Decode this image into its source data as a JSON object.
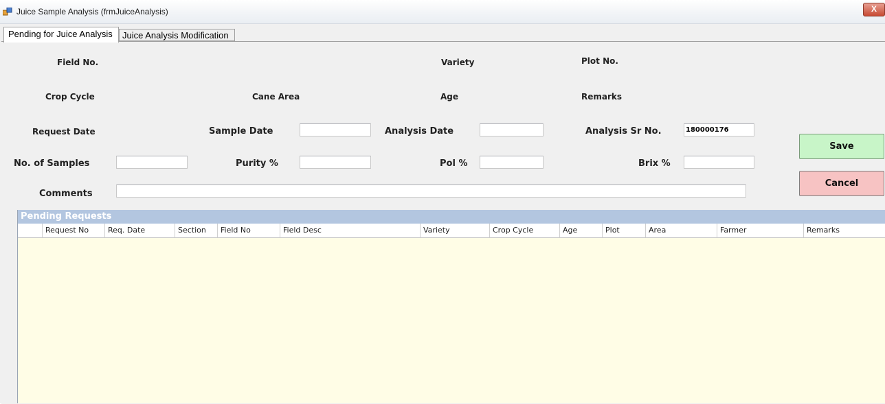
{
  "window": {
    "title": "Juice Sample Analysis (frmJuiceAnalysis)",
    "close_label": "X"
  },
  "tabs": [
    {
      "label": "Pending for Juice Analysis",
      "active": true
    },
    {
      "label": "Juice Analysis Modification",
      "active": false
    }
  ],
  "form": {
    "field_no": "Field No.",
    "variety": "Variety",
    "plot_no": "Plot No.",
    "crop_cycle": "Crop Cycle",
    "cane_area": "Cane Area",
    "age": "Age",
    "remarks": "Remarks",
    "request_date": "Request Date",
    "sample_date": {
      "label": "Sample Date",
      "value": ""
    },
    "analysis_date": {
      "label": "Analysis Date",
      "value": ""
    },
    "analysis_sr_no": {
      "label": "Analysis Sr No.",
      "value": "180000176"
    },
    "no_of_samples": {
      "label": "No. of Samples",
      "value": ""
    },
    "purity": {
      "label": "Purity %",
      "value": ""
    },
    "pol": {
      "label": "Pol %",
      "value": ""
    },
    "brix": {
      "label": "Brix %",
      "value": ""
    },
    "comments": {
      "label": "Comments",
      "value": ""
    }
  },
  "buttons": {
    "save": "Save",
    "cancel": "Cancel"
  },
  "grid": {
    "title": "Pending Requests",
    "columns": [
      "Request No",
      "Req. Date",
      "Section",
      "Field No",
      "Field Desc",
      "Variety",
      "Crop Cycle",
      "Age",
      "Plot",
      "Area",
      "Farmer",
      "Remarks"
    ],
    "rows": []
  },
  "colors": {
    "grid_title_bg": "#b3c6e0",
    "grid_body_bg": "#fffde6",
    "save_bg": "#c8f5c8",
    "cancel_bg": "#f7c3c3"
  }
}
